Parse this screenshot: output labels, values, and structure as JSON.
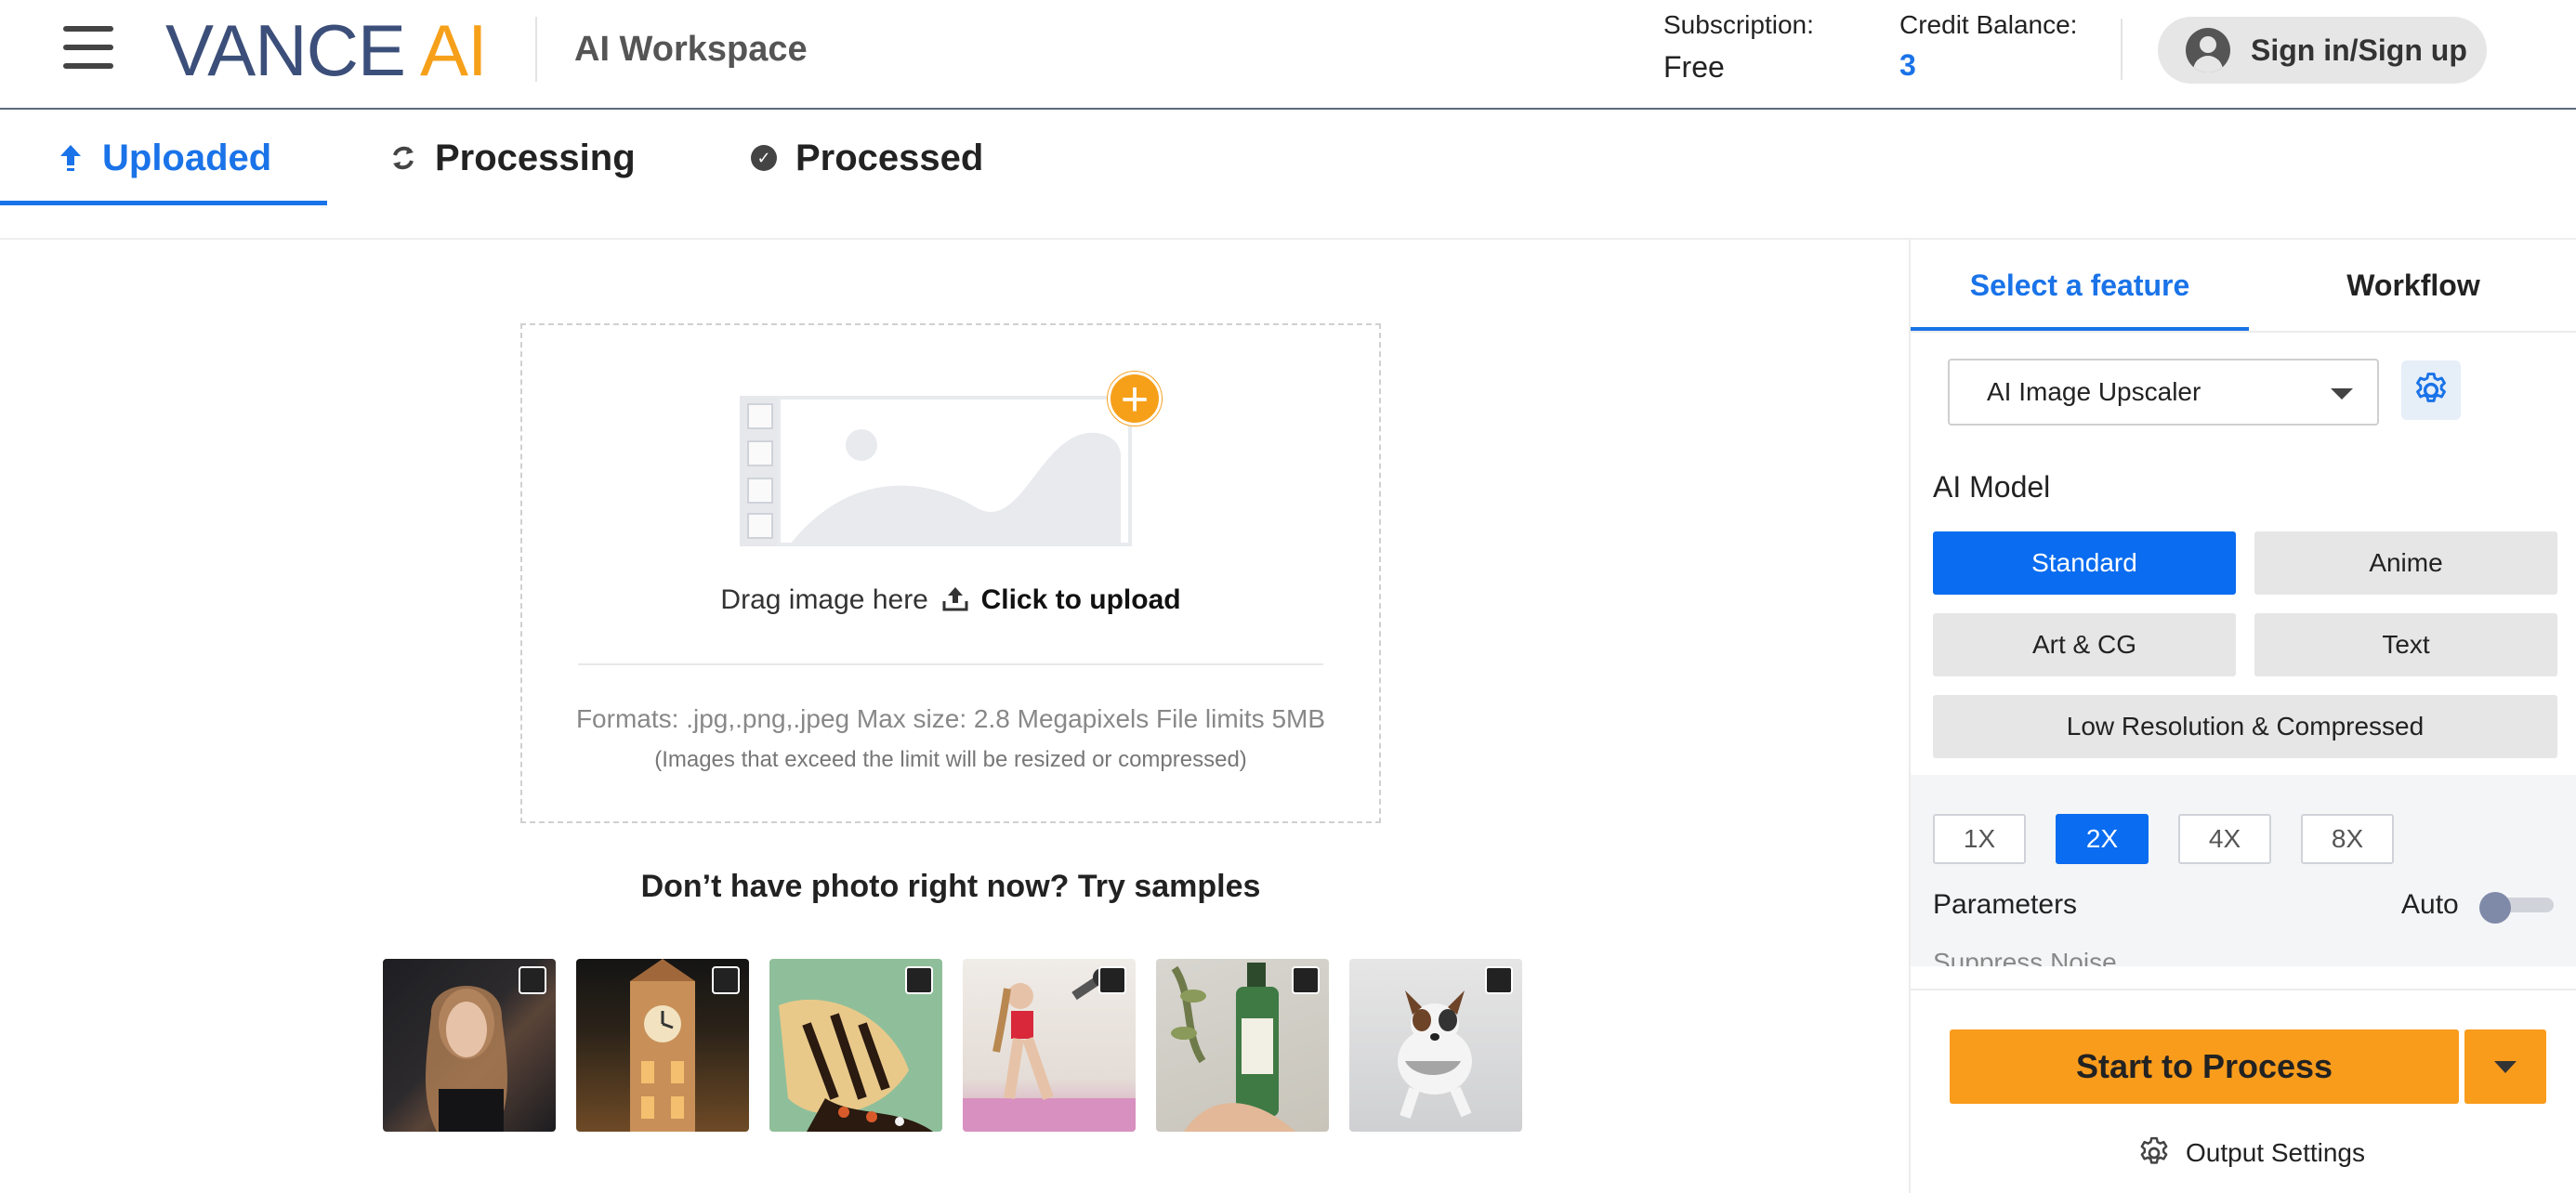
{
  "header": {
    "logo_left": "VANCE",
    "logo_right": "AI",
    "workspace_title": "AI Workspace",
    "subscription_label": "Subscription:",
    "subscription_value": "Free",
    "credit_label": "Credit Balance:",
    "credit_value": "3",
    "signin_label": "Sign in/Sign up"
  },
  "status_tabs": [
    {
      "label": "Uploaded",
      "icon": "upload-arrow-icon",
      "active": true
    },
    {
      "label": "Processing",
      "icon": "refresh-icon",
      "active": false
    },
    {
      "label": "Processed",
      "icon": "check-circle-icon",
      "active": false
    }
  ],
  "upload": {
    "drag_text": "Drag image here",
    "click_text": "Click to upload",
    "formats_text": "Formats: .jpg,.png,.jpeg Max size: 2.8 Megapixels File limits 5MB",
    "formats_note": "(Images that exceed the limit will be resized or compressed)"
  },
  "samples": {
    "title": "Don’t have photo right now? Try samples",
    "items": [
      {
        "name": "portrait-woman",
        "checked": false
      },
      {
        "name": "clock-tower",
        "checked": false
      },
      {
        "name": "butterfly",
        "checked": false
      },
      {
        "name": "fitness-woman",
        "checked": false
      },
      {
        "name": "bottle-product",
        "checked": false
      },
      {
        "name": "running-dog",
        "checked": false
      }
    ]
  },
  "panel": {
    "tabs": [
      {
        "label": "Select a feature",
        "active": true
      },
      {
        "label": "Workflow",
        "active": false
      }
    ],
    "feature_selected": "AI Image Upscaler",
    "model_label": "AI Model",
    "models": [
      {
        "label": "Standard",
        "active": true
      },
      {
        "label": "Anime",
        "active": false
      },
      {
        "label": "Art & CG",
        "active": false
      },
      {
        "label": "Text",
        "active": false
      },
      {
        "label": "Low Resolution & Compressed",
        "active": false
      }
    ],
    "scales": [
      {
        "label": "1X",
        "active": false
      },
      {
        "label": "2X",
        "active": true
      },
      {
        "label": "4X",
        "active": false
      },
      {
        "label": "8X",
        "active": false
      }
    ],
    "parameters_label": "Parameters",
    "auto_label": "Auto",
    "auto_enabled": false,
    "suppress_label": "Suppress Noise",
    "start_label": "Start to Process",
    "output_settings_label": "Output Settings"
  },
  "colors": {
    "accent_blue": "#1a73e8",
    "brand_orange": "#f6a01a",
    "logo_navy": "#3c4f7a"
  }
}
